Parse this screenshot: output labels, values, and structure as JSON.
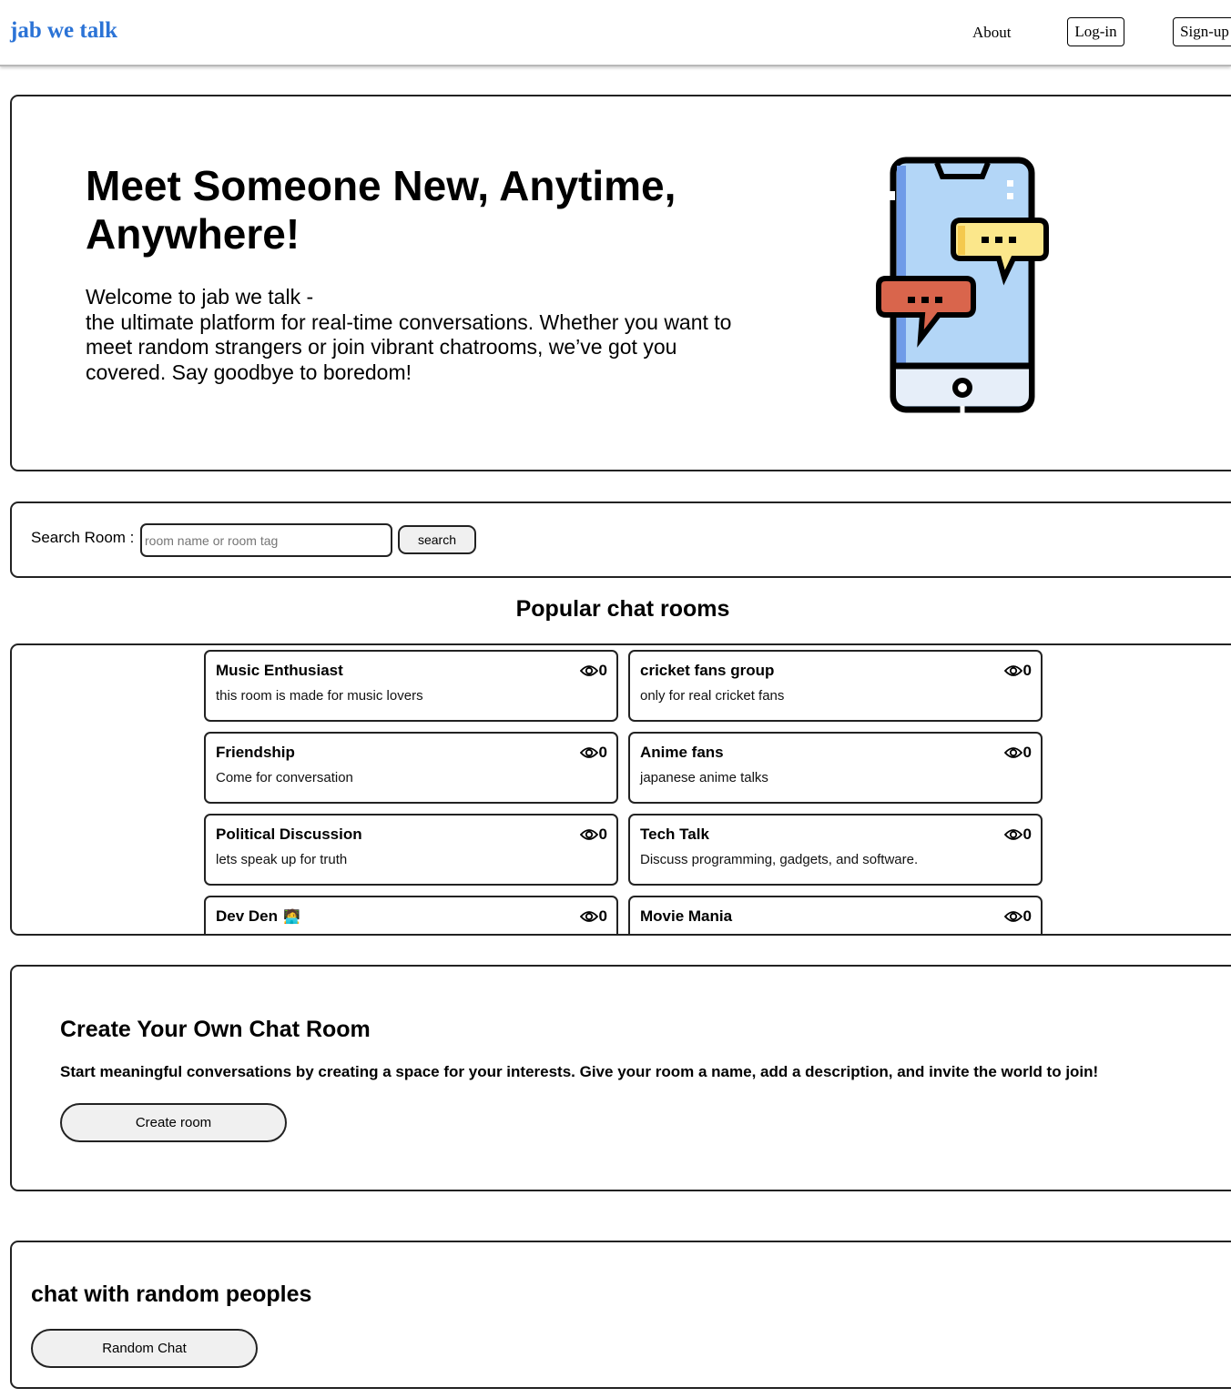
{
  "nav": {
    "brand": "jab we talk",
    "about": "About",
    "login": "Log-in",
    "signup": "Sign-up"
  },
  "hero": {
    "title": "Meet Someone New, Anytime, Anywhere!",
    "intro_line1": "Welcome to jab we talk -",
    "intro_line2": "the ultimate platform for real-time conversations. Whether you want to meet random strangers or join vibrant chatrooms, we’ve got you covered. Say goodbye to boredom!",
    "illustration": "phone-chat-illustration"
  },
  "search": {
    "label": "Search Room :",
    "placeholder": "room name or room tag",
    "value": "",
    "button": "search"
  },
  "popular": {
    "title": "Popular chat rooms",
    "view_icon": "eye-icon",
    "rooms": [
      {
        "name": "Music Enthusiast",
        "desc": "this room is made for music lovers",
        "views": "0",
        "emoji": ""
      },
      {
        "name": "cricket fans group",
        "desc": "only for real cricket fans",
        "views": "0",
        "emoji": ""
      },
      {
        "name": "Friendship",
        "desc": "Come for conversation",
        "views": "0",
        "emoji": ""
      },
      {
        "name": "Anime fans",
        "desc": "japanese anime talks",
        "views": "0",
        "emoji": ""
      },
      {
        "name": "Political Discussion",
        "desc": "lets speak up for truth",
        "views": "0",
        "emoji": ""
      },
      {
        "name": "Tech Talk",
        "desc": "Discuss programming, gadgets, and software.",
        "views": "0",
        "emoji": ""
      },
      {
        "name": "Dev Den",
        "desc": "",
        "views": "0",
        "emoji": "🧑‍💻"
      },
      {
        "name": "Movie Mania",
        "desc": "",
        "views": "0",
        "emoji": ""
      }
    ]
  },
  "create": {
    "title": "Create Your Own Chat Room",
    "text": "Start meaningful conversations by creating a space for your interests. Give your room a name, add a description, and invite the world to join!",
    "button": "Create room"
  },
  "random": {
    "title": "chat with random peoples",
    "button": "Random Chat"
  },
  "colors": {
    "brand": "#2b73d6",
    "phone_screen": "#b3d6f7",
    "bubble_yellow": "#fbe78b",
    "bubble_red": "#d9654c",
    "button_bg": "#f0f0f0"
  }
}
